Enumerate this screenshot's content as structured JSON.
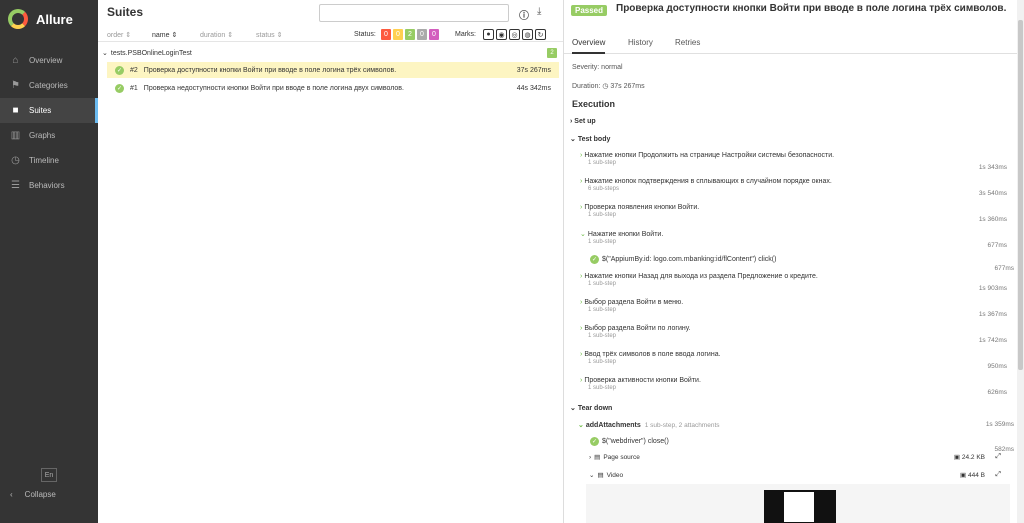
{
  "app": {
    "name": "Allure"
  },
  "sidebar": {
    "items": [
      {
        "label": "Overview",
        "icon": "home-icon"
      },
      {
        "label": "Categories",
        "icon": "flag-icon"
      },
      {
        "label": "Suites",
        "icon": "briefcase-icon"
      },
      {
        "label": "Graphs",
        "icon": "bar-chart-icon"
      },
      {
        "label": "Timeline",
        "icon": "clock-icon"
      },
      {
        "label": "Behaviors",
        "icon": "list-icon"
      }
    ],
    "language": "En",
    "collapse_label": "Collapse"
  },
  "suites": {
    "title": "Suites",
    "sort": {
      "order": "order",
      "name": "name",
      "duration": "duration",
      "status": "status"
    },
    "status_label": "Status:",
    "status_counts": [
      "0",
      "0",
      "2",
      "0",
      "0"
    ],
    "marks_label": "Marks:",
    "group": {
      "name": "tests.PSBOnlineLoginTest",
      "count": "2"
    },
    "tests": [
      {
        "num": "#2",
        "name": "Проверка доступности кнопки Войти при вводе в поле логина трёх символов.",
        "duration": "37s 267ms"
      },
      {
        "num": "#1",
        "name": "Проверка недоступности кнопки Войти при вводе в поле логина двух символов.",
        "duration": "44s 342ms"
      }
    ]
  },
  "detail": {
    "status": "Passed",
    "title": "Проверка доступности кнопки Войти при вводе в поле логина трёх символов.",
    "tabs": [
      "Overview",
      "History",
      "Retries"
    ],
    "severity": "Severity: normal",
    "duration": "Duration: ◷ 37s 267ms",
    "execution_label": "Execution",
    "setup_label": "Set up",
    "testbody_label": "Test body",
    "steps": [
      {
        "name": "Нажатие кнопки Продолжить на странице Настройки системы безопасности.",
        "sub": "1 sub-step",
        "duration": "1s 343ms"
      },
      {
        "name": "Нажатие кнопок подтверждения в сплывающих в случайном порядке окнах.",
        "sub": "6 sub-steps",
        "duration": "3s 540ms"
      },
      {
        "name": "Проверка появления кнопки Войти.",
        "sub": "1 sub-step",
        "duration": "1s 360ms"
      },
      {
        "name": "Нажатие кнопки Войти.",
        "sub": "1 sub-step",
        "duration": "677ms"
      },
      {
        "name": "Нажатие кнопки Назад для выхода из раздела Предложение о кредите.",
        "sub": "1 sub-step",
        "duration": "1s 903ms"
      },
      {
        "name": "Выбор раздела Войти в меню.",
        "sub": "1 sub-step",
        "duration": "1s 367ms"
      },
      {
        "name": "Выбор раздела Войти по логину.",
        "sub": "1 sub-step",
        "duration": "1s 742ms"
      },
      {
        "name": "Ввод трёх символов в поле ввода логина.",
        "sub": "1 sub-step",
        "duration": "950ms"
      },
      {
        "name": "Проверка активности кнопки Войти.",
        "sub": "1 sub-step",
        "duration": "626ms"
      }
    ],
    "substep": {
      "name": "$(\"AppiumBy.id: logo.com.mbanking:id/flContent\") click()",
      "duration": "677ms"
    },
    "teardown_label": "Tear down",
    "add_attachments": {
      "name": "addAttachments",
      "meta": "1 sub-step, 2 attachments",
      "duration": "1s 359ms"
    },
    "webdriver_close": {
      "name": "$(\"webdriver\") close()",
      "duration": "582ms"
    },
    "attachments": [
      {
        "name": "Page source",
        "size": "24.2 KB"
      },
      {
        "name": "Video",
        "size": "444 B"
      }
    ]
  }
}
